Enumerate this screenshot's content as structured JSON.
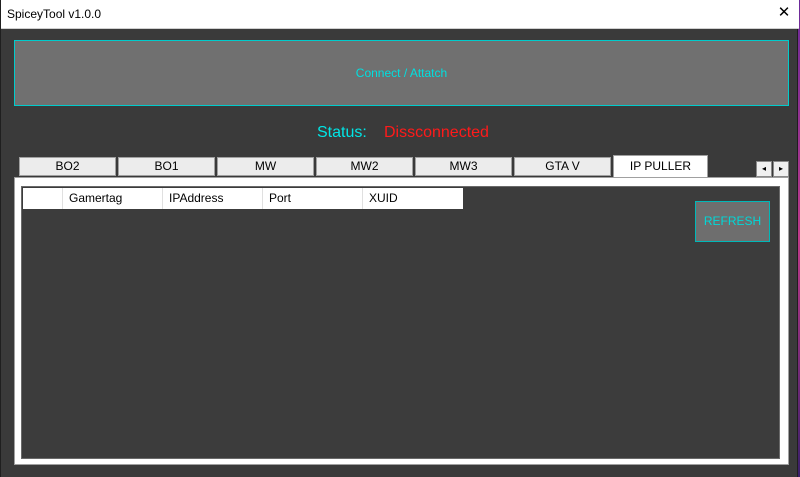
{
  "window": {
    "title": "SpiceyTool v1.0.0",
    "close_glyph": "✕"
  },
  "connect": {
    "label": "Connect / Attatch"
  },
  "status": {
    "label": "Status:",
    "value": "Dissconnected",
    "label_color": "#00e5e5",
    "value_color": "#ff1a1a"
  },
  "tabs": [
    {
      "label": "BO2"
    },
    {
      "label": "BO1"
    },
    {
      "label": "MW"
    },
    {
      "label": "MW2"
    },
    {
      "label": "MW3"
    },
    {
      "label": "GTA V"
    },
    {
      "label": "IP PULLER",
      "active": true
    }
  ],
  "tab_scroll": {
    "left_icon": "scroll-left-icon",
    "right_icon": "scroll-right-icon",
    "left_glyph": "◂",
    "right_glyph": "▸"
  },
  "grid": {
    "columns": [
      "",
      "Gamertag",
      "IPAddress",
      "Port",
      "XUID"
    ],
    "rows": []
  },
  "refresh": {
    "label": "REFRESH"
  },
  "colors": {
    "accent": "#00cccc",
    "panel": "#3c3c3c",
    "button": "#707070"
  }
}
